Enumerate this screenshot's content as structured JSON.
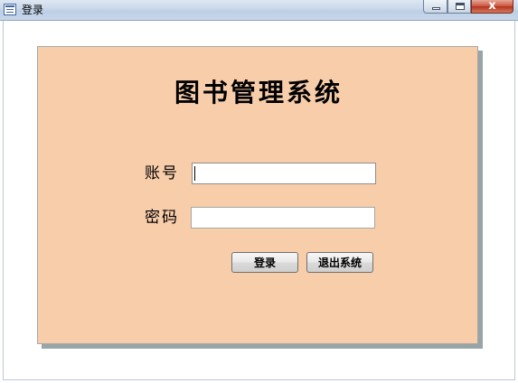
{
  "window": {
    "title": "登录",
    "icon": "form-icon",
    "controls": {
      "minimize_icon": "minimize-icon",
      "maximize_icon": "maximize-icon",
      "close_glyph": "x"
    }
  },
  "form": {
    "system_title": "图书管理系统",
    "account_label": "账号",
    "account_value": "",
    "password_label": "密码",
    "password_value": "",
    "login_button": "登录",
    "exit_button": "退出系统"
  },
  "colors": {
    "panel_background": "#f8cdaa",
    "panel_shadow": "#97a5a6",
    "titlebar": "#c9d8ea",
    "close_button": "#c8543d"
  }
}
